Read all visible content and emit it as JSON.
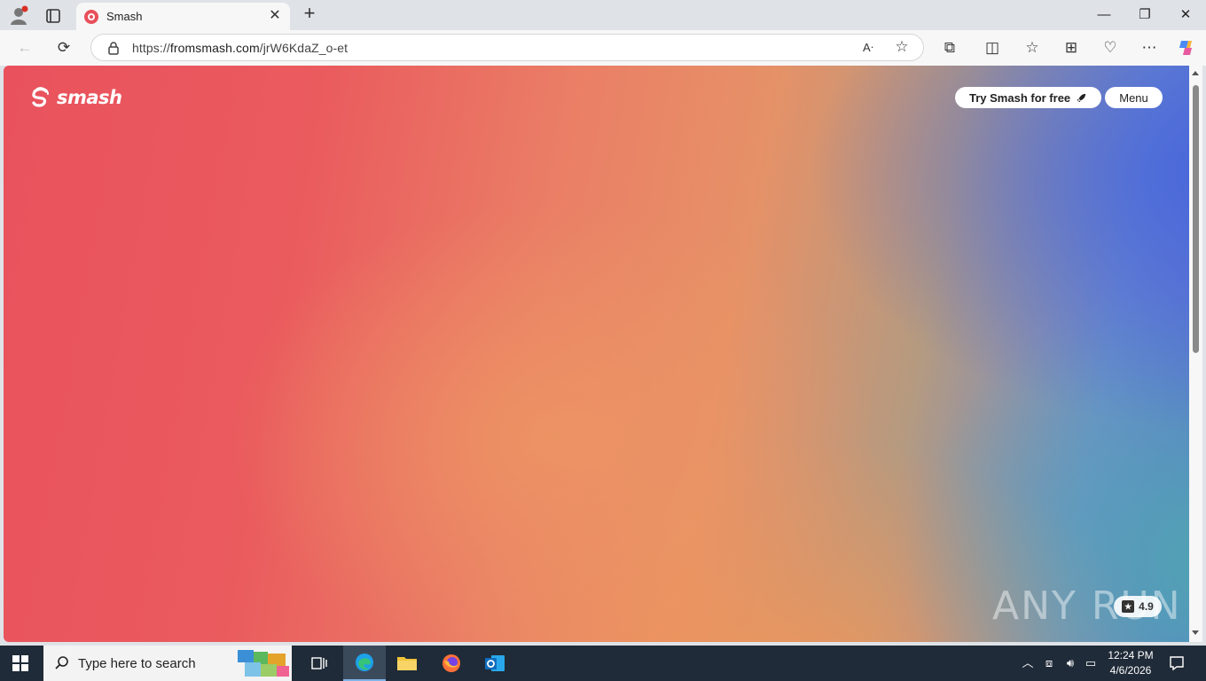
{
  "browser": {
    "tab": {
      "title": "Smash"
    },
    "address": {
      "url_prefix": "https://",
      "url_host": "fromsmash.com",
      "url_path": "/jrW6KdaZ_o-et"
    }
  },
  "page": {
    "logo_text": "smash",
    "try_button": "Try Smash for free",
    "menu_button": "Menu",
    "rating_value": "4.9",
    "watermark": "ANY RUN"
  },
  "taskbar": {
    "search_placeholder": "Type here to search",
    "time": "12:24 PM",
    "date": "4/6/2026"
  },
  "colors": {
    "brand_red": "#e9525d",
    "gradient_blue": "#5b6fd2",
    "gradient_teal": "#50aaaf",
    "gradient_orange": "#ed9664",
    "taskbar_bg": "#1f2b38"
  }
}
